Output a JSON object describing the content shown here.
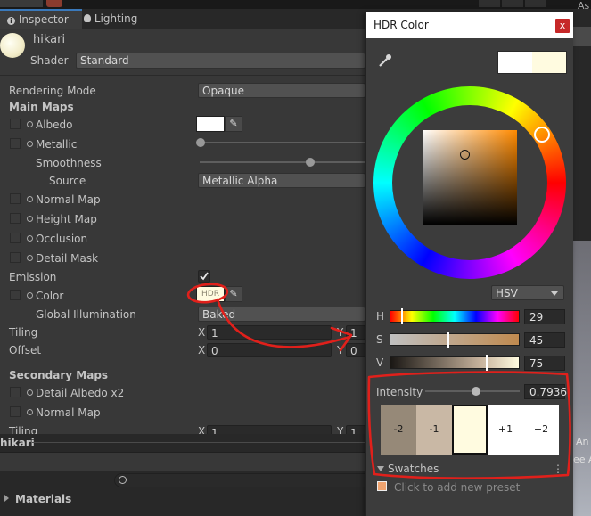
{
  "tabs": [
    {
      "label": "Inspector",
      "icon": "info-icon"
    },
    {
      "label": "Lighting",
      "icon": "bulb-icon"
    }
  ],
  "material": {
    "name": "hikari",
    "shader_label": "Shader",
    "shader_value": "Standard"
  },
  "props": {
    "rendering_mode_label": "Rendering Mode",
    "rendering_mode_value": "Opaque",
    "main_maps": "Main Maps",
    "albedo": "Albedo",
    "metallic": "Metallic",
    "smoothness": "Smoothness",
    "source_label": "Source",
    "source_value": "Metallic Alpha",
    "normal_map": "Normal Map",
    "height_map": "Height Map",
    "occlusion": "Occlusion",
    "detail_mask": "Detail Mask",
    "emission": "Emission",
    "color": "Color",
    "hdr_badge": "HDR",
    "global_illum_label": "Global Illumination",
    "global_illum_value": "Baked",
    "tiling": "Tiling",
    "offset": "Offset",
    "tiling_x_label": "X",
    "tiling_x_value": "1",
    "tiling_y_label": "Y",
    "tiling_y_value": "1",
    "offset_x_label": "X",
    "offset_x_value": "0",
    "offset_y_label": "Y",
    "offset_y_value": "0",
    "secondary_maps": "Secondary Maps",
    "detail_albedo": "Detail Albedo x2",
    "normal_map2": "Normal Map",
    "tiling2": "Tiling",
    "tiling2_x_label": "X",
    "tiling2_x_value": "1",
    "tiling2_y_label": "Y",
    "tiling2_y_value": "1"
  },
  "footer": {
    "object_name": "hikari",
    "materials": "Materials",
    "search_icon": "search-icon"
  },
  "hdr": {
    "title": "HDR Color",
    "close": "x",
    "mode": "HSV",
    "h_label": "H",
    "h_value": "29",
    "s_label": "S",
    "s_value": "45",
    "v_label": "V",
    "v_value": "75",
    "intensity_label": "Intensity",
    "intensity_value": "0.7936",
    "stops": [
      "-2",
      "-1",
      "",
      "+1",
      "+2"
    ],
    "swatches_label": "Swatches",
    "preset_hint": "Click to add new preset"
  },
  "right_edge": {
    "top_text": "As",
    "mid_text_1": "An",
    "mid_text_2": "ee A"
  },
  "colors": {
    "accent": "#3a79bb",
    "selected_color": "#fffbe0",
    "annotation": "#e0201b",
    "close_red": "#c62828"
  }
}
